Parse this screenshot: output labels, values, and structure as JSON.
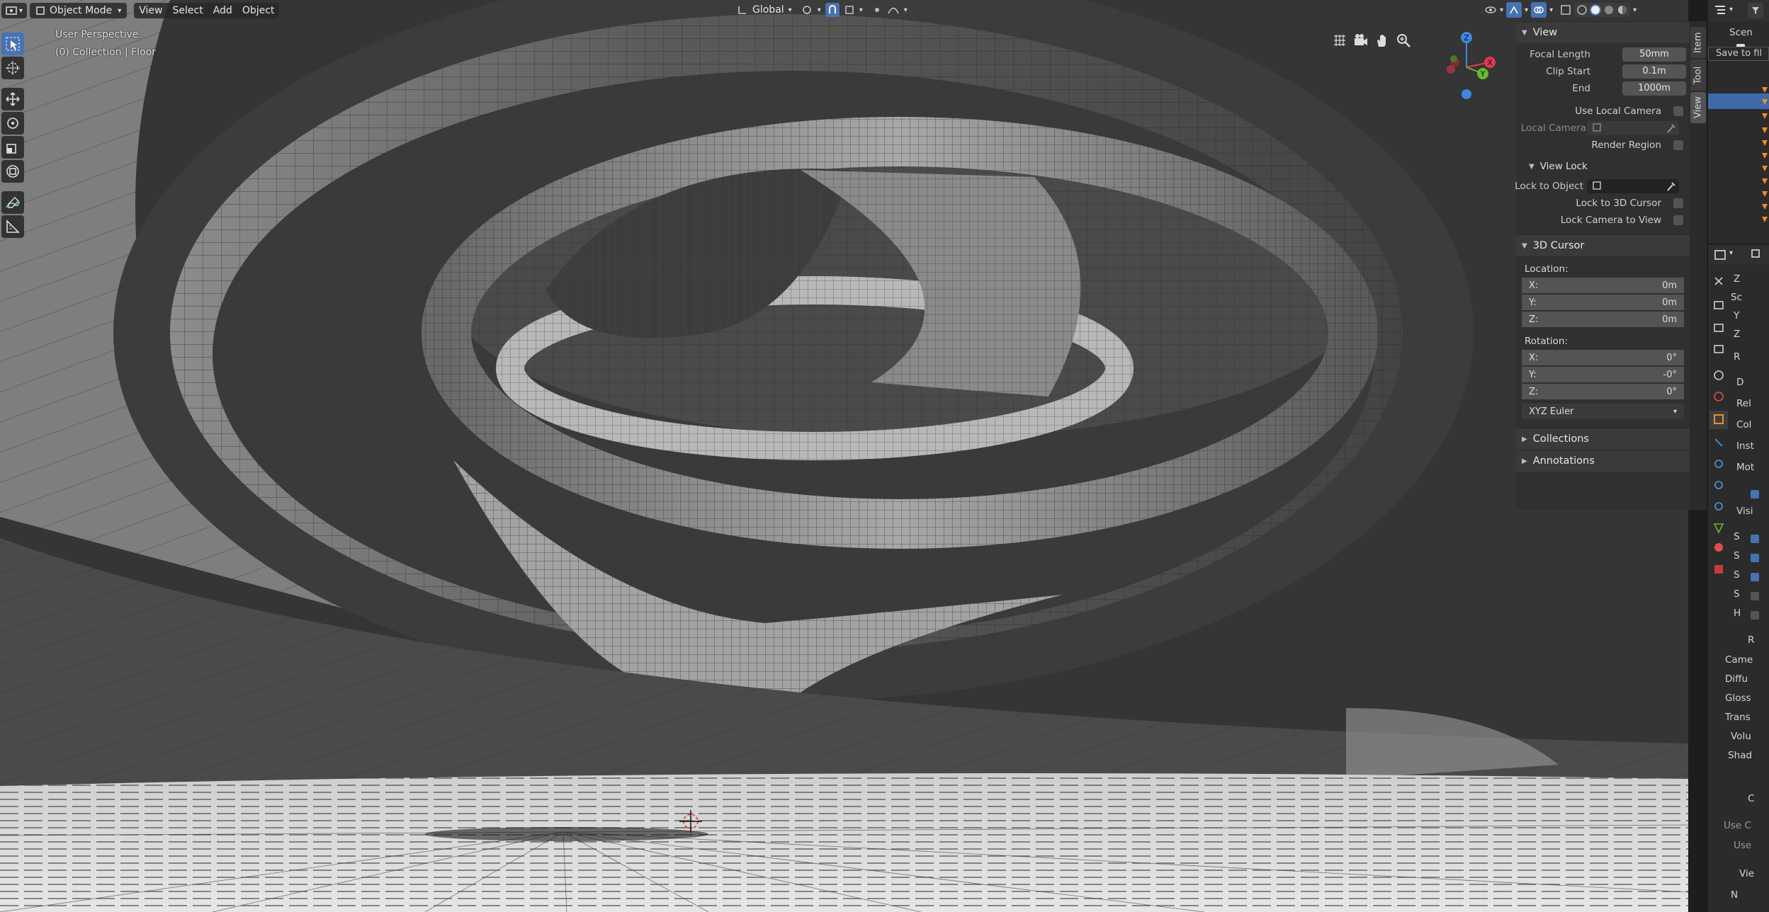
{
  "header": {
    "mode": "Object Mode",
    "menus": [
      "View",
      "Select",
      "Add",
      "Object"
    ],
    "orientation": "Global"
  },
  "viewport": {
    "perspective_label": "User Perspective",
    "collection_label": "(0) Collection | Floor",
    "gizmo_axes": {
      "z": "Z",
      "x": "X",
      "y": "Y"
    }
  },
  "sidebar_tabs": [
    "Item",
    "Tool",
    "View"
  ],
  "npanel": {
    "view": {
      "title": "View",
      "focal_length_label": "Focal Length",
      "focal_length": "50mm",
      "clip_start_label": "Clip Start",
      "clip_start": "0.1m",
      "end_label": "End",
      "end": "1000m",
      "use_local_camera": "Use Local Camera",
      "local_camera": "Local Camera",
      "render_region": "Render Region"
    },
    "view_lock": {
      "title": "View Lock",
      "lock_to_object": "Lock to Object",
      "lock_to_3d_cursor": "Lock to 3D Cursor",
      "lock_camera_to_view": "Lock Camera to View"
    },
    "cursor": {
      "title": "3D Cursor",
      "location_label": "Location:",
      "loc": [
        {
          "axis": "X:",
          "value": "0m"
        },
        {
          "axis": "Y:",
          "value": "0m"
        },
        {
          "axis": "Z:",
          "value": "0m"
        }
      ],
      "rotation_label": "Rotation:",
      "rot": [
        {
          "axis": "X:",
          "value": "0°"
        },
        {
          "axis": "Y:",
          "value": "-0°"
        },
        {
          "axis": "Z:",
          "value": "0°"
        }
      ],
      "rotation_mode": "XYZ Euler"
    },
    "collections": "Collections",
    "annotations": "Annotations"
  },
  "outliner": {
    "scene_text": "Scen",
    "tooltip": "Save to fil"
  },
  "properties": {
    "fragments": [
      "Z",
      "Sc",
      "Y",
      "Z",
      "R",
      "D",
      "Rel",
      "Col",
      "Inst",
      "Mot",
      "Visi",
      "S",
      "S",
      "S",
      "S",
      "H",
      "R",
      "Came",
      "Diffu",
      "Gloss",
      "Trans",
      "Volu",
      "Shad",
      "C",
      "Use C",
      "Use",
      "Vie",
      "N"
    ]
  },
  "colors": {
    "accent": "#4772b3",
    "axis_x": "#e3384d",
    "axis_y": "#6ab82e",
    "axis_z": "#3f87e3",
    "selected_row": "#3f6aa8",
    "object_orange": "#f08b2e"
  }
}
